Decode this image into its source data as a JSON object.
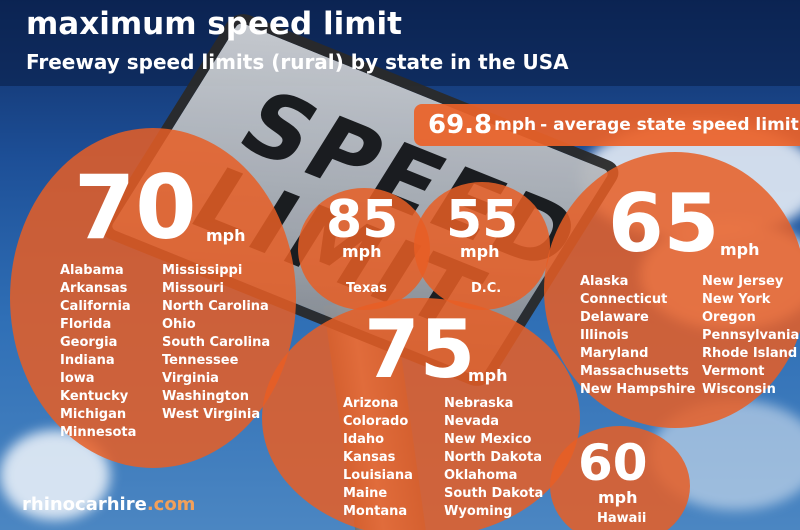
{
  "title": "maximum speed limit",
  "subtitle": "Freeway speed limits (rural) by state in the USA",
  "average": {
    "value": "69.8",
    "unit": "mph",
    "label": "- average state speed limit"
  },
  "sign": {
    "text": "SPEED LIMIT"
  },
  "groups": {
    "g70": {
      "speed": "70",
      "unit": "mph",
      "states_left": [
        "Alabama",
        "Arkansas",
        "California",
        "Florida",
        "Georgia",
        "Indiana",
        "Iowa",
        "Kentucky",
        "Michigan",
        "Minnesota"
      ],
      "states_right": [
        "Mississippi",
        "Missouri",
        "North Carolina",
        "Ohio",
        "South Carolina",
        "Tennessee",
        "Virginia",
        "Washington",
        "West Virginia"
      ]
    },
    "g85": {
      "speed": "85",
      "unit": "mph",
      "states": [
        "Texas"
      ]
    },
    "g55": {
      "speed": "55",
      "unit": "mph",
      "states": [
        "D.C."
      ]
    },
    "g65": {
      "speed": "65",
      "unit": "mph",
      "states_left": [
        "Alaska",
        "Connecticut",
        "Delaware",
        "Illinois",
        "Maryland",
        "Massachusetts",
        "New Hampshire"
      ],
      "states_right": [
        "New Jersey",
        "New York",
        "Oregon",
        "Pennsylvania",
        "Rhode Island",
        "Vermont",
        "Wisconsin"
      ]
    },
    "g75": {
      "speed": "75",
      "unit": "mph",
      "states_left": [
        "Arizona",
        "Colorado",
        "Idaho",
        "Kansas",
        "Louisiana",
        "Maine",
        "Montana"
      ],
      "states_right": [
        "Nebraska",
        "Nevada",
        "New Mexico",
        "North Dakota",
        "Oklahoma",
        "South Dakota",
        "Wyoming"
      ]
    },
    "g60": {
      "speed": "60",
      "unit": "mph",
      "states": [
        "Hawaii"
      ]
    }
  },
  "brand": {
    "name": "rhinocarhire",
    "tld": ".com"
  },
  "colors": {
    "circle": "#e85e24",
    "accent": "#f2a05a",
    "sky": "#1d4f97"
  }
}
